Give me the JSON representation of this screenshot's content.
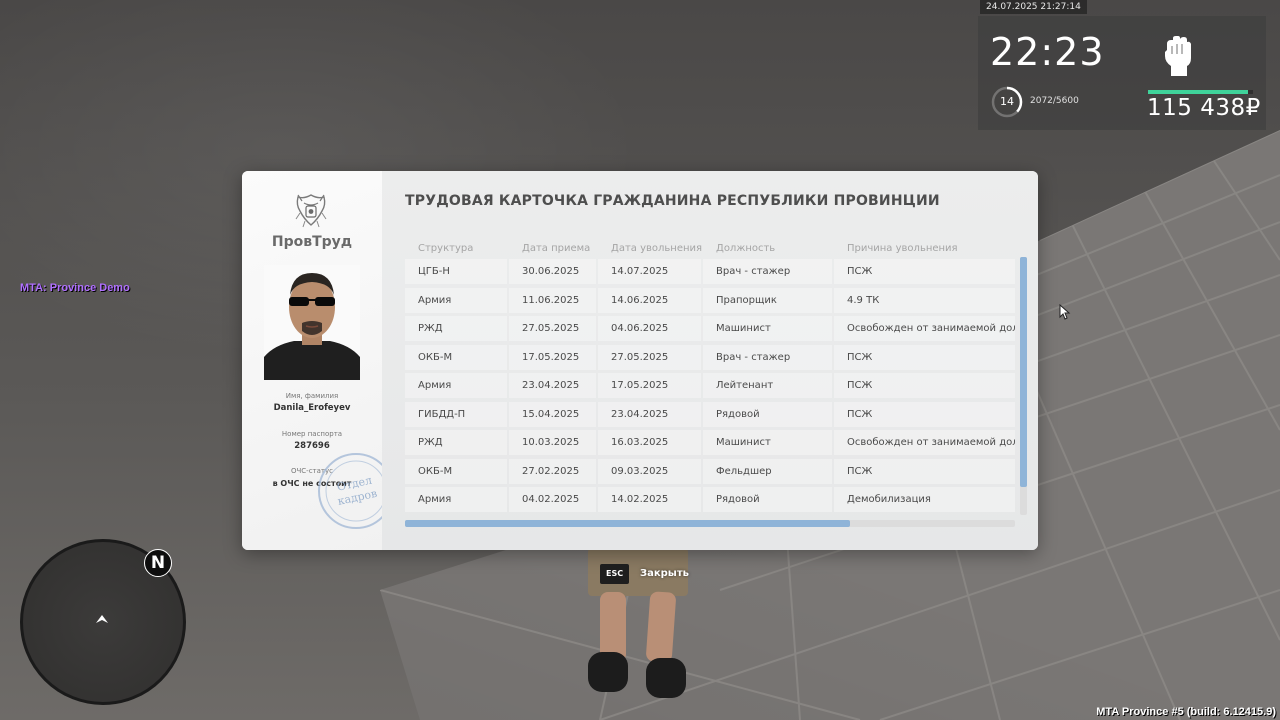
{
  "hud": {
    "datetime": "24.07.2025 21:27:14",
    "time": "22:23",
    "level": "14",
    "experience": "2072/5600",
    "money": "115 438₽",
    "armor_fraction": 0.95,
    "level_progress": 0.37,
    "fist_icon": "fist-icon"
  },
  "server_label": "MTA: Province Demo",
  "build_label": "MTA Province #5 (build: 6.12415.9)",
  "radar": {
    "north_label": "N"
  },
  "work_card": {
    "brand": "ПровТруд",
    "title": "ТРУДОВАЯ КАРТОЧКА ГРАЖДАНИНА РЕСПУБЛИКИ ПРОВИНЦИИ",
    "name_label": "Имя, фамилия",
    "name_value": "Danila_Erofeyev",
    "passport_label": "Номер паспорта",
    "passport_value": "287696",
    "ochs_label": "ОЧС-статус",
    "ochs_value": "в ОЧС не состоит",
    "stamp_lines": [
      "Отдел",
      "кадров"
    ],
    "columns": [
      "Структура",
      "Дата приема",
      "Дата увольнения",
      "Должность",
      "Причина увольнения"
    ],
    "rows": [
      [
        "ЦГБ-Н",
        "30.06.2025",
        "14.07.2025",
        "Врач - стажер",
        "ПСЖ"
      ],
      [
        "Армия",
        "11.06.2025",
        "14.06.2025",
        "Прапорщик",
        "4.9 ТК"
      ],
      [
        "РЖД",
        "27.05.2025",
        "04.06.2025",
        "Машинист",
        "Освобожден от занимаемой долж"
      ],
      [
        "ОКБ-М",
        "17.05.2025",
        "27.05.2025",
        "Врач - стажер",
        "ПСЖ"
      ],
      [
        "Армия",
        "23.04.2025",
        "17.05.2025",
        "Лейтенант",
        "ПСЖ"
      ],
      [
        "ГИБДД-П",
        "15.04.2025",
        "23.04.2025",
        "Рядовой",
        "ПСЖ"
      ],
      [
        "РЖД",
        "10.03.2025",
        "16.03.2025",
        "Машинист",
        "Освобожден от занимаемой долж"
      ],
      [
        "ОКБ-М",
        "27.02.2025",
        "09.03.2025",
        "Фельдшер",
        "ПСЖ"
      ],
      [
        "Армия",
        "04.02.2025",
        "14.02.2025",
        "Рядовой",
        "Демобилизация"
      ]
    ],
    "horizontal_scroll_fraction": 0.73,
    "accent_color": "#8fb4d8"
  },
  "close_hint": {
    "key": "ESC",
    "label": "Закрыть"
  }
}
